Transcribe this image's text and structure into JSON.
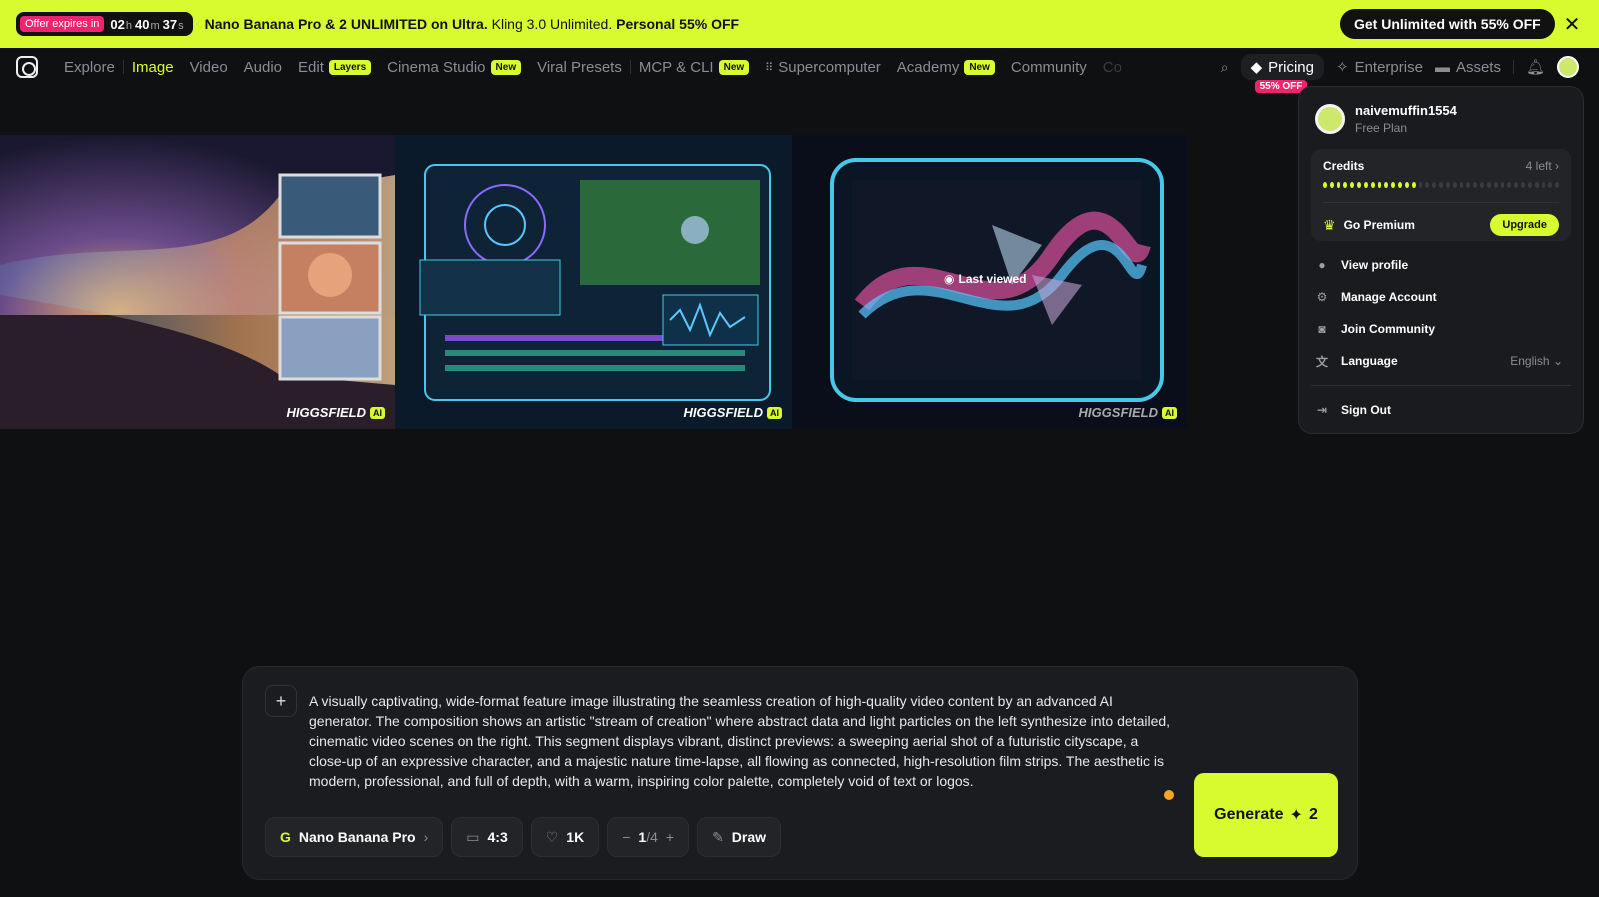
{
  "promo": {
    "offer_label": "Offer expires in",
    "hours": "02",
    "hours_unit": "h",
    "minutes": "40",
    "minutes_unit": "m",
    "seconds": "37",
    "seconds_unit": "s",
    "text_bold": "Nano Banana Pro & 2 UNLIMITED on Ultra.",
    "text_mid": " Kling 3.0 Unlimited. ",
    "text_bold2": "Personal 55% OFF",
    "cta": "Get Unlimited with 55% OFF",
    "close": "✕"
  },
  "nav": {
    "items": [
      {
        "label": "Explore"
      },
      {
        "label": "Image"
      },
      {
        "label": "Video"
      },
      {
        "label": "Audio"
      },
      {
        "label": "Edit",
        "badge": "Layers"
      },
      {
        "label": "Cinema Studio",
        "badge": "New"
      },
      {
        "label": "Viral Presets"
      },
      {
        "label": "MCP & CLI",
        "badge": "New"
      },
      {
        "label": "Supercomputer"
      },
      {
        "label": "Academy",
        "badge": "New"
      },
      {
        "label": "Community"
      },
      {
        "label": "Co"
      }
    ],
    "pricing": "Pricing",
    "pricing_badge": "55% OFF",
    "enterprise": "Enterprise",
    "assets": "Assets"
  },
  "hero": {
    "watermark": "HIGGSFIELD",
    "watermark_badge": "AI",
    "last_viewed": "Last viewed"
  },
  "account": {
    "username": "naivemuffin1554",
    "plan": "Free Plan",
    "credits_label": "Credits",
    "credits_left": "4 left",
    "credits_used_dots": 14,
    "credits_total_dots": 35,
    "go_premium": "Go Premium",
    "upgrade": "Upgrade",
    "menu": [
      {
        "label": "View profile",
        "icon": "user-icon"
      },
      {
        "label": "Manage Account",
        "icon": "gear-icon"
      },
      {
        "label": "Join Community",
        "icon": "discord-icon"
      },
      {
        "label": "Language",
        "icon": "translate-icon",
        "value": "English"
      }
    ],
    "sign_out": "Sign Out"
  },
  "prompt": {
    "text": "A visually captivating, wide-format feature image illustrating the seamless creation of high-quality video content by an advanced AI generator. The composition shows an artistic \"stream of creation\" where abstract data and light particles on the left synthesize into detailed, cinematic video scenes on the right. This segment displays vibrant, distinct previews: a sweeping aerial shot of a futuristic cityscape, a close-up of an expressive character, and a majestic nature time-lapse, all flowing as connected, high-resolution film strips. The aesthetic is modern, professional, and full of depth, with a warm, inspiring color palette, completely void of text or logos.",
    "model": "Nano Banana Pro",
    "ratio": "4:3",
    "resolution": "1K",
    "count": "1",
    "count_total": "/4",
    "draw": "Draw",
    "generate": "Generate",
    "generate_cost": "2"
  },
  "colors": {
    "accent": "#d8fb2f",
    "pink": "#f0246e",
    "background": "#0f1012"
  }
}
